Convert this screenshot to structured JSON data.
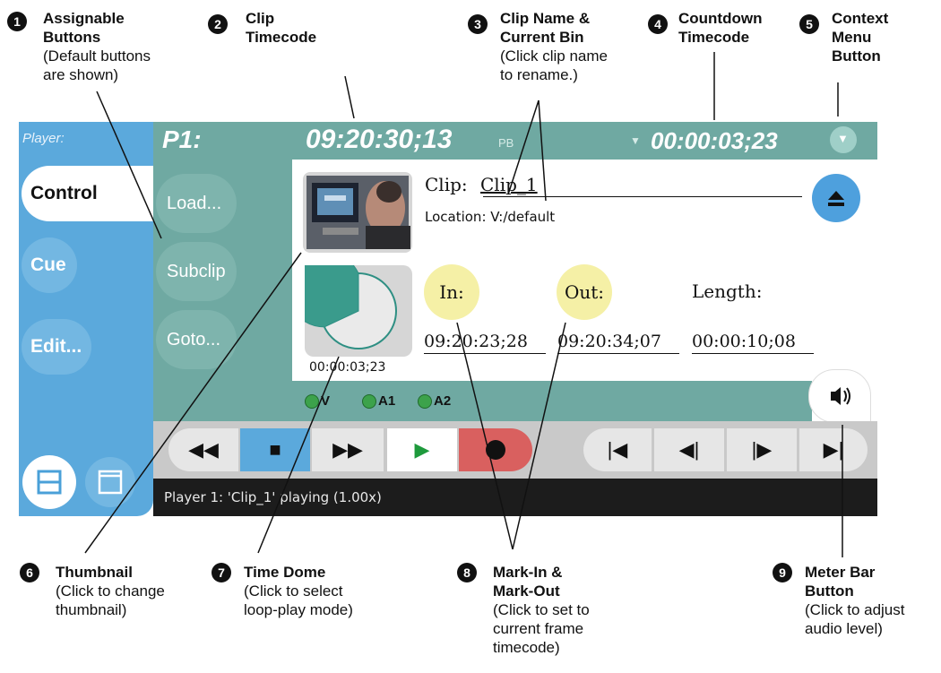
{
  "callouts": [
    {
      "num": "1",
      "title": "Assignable\nButtons",
      "desc": "(Default buttons\nare shown)"
    },
    {
      "num": "2",
      "title": "Clip\nTimecode",
      "desc": ""
    },
    {
      "num": "3",
      "title": "Clip Name &\nCurrent Bin",
      "desc": "(Click clip name\nto rename.)"
    },
    {
      "num": "4",
      "title": "Countdown\nTimecode",
      "desc": ""
    },
    {
      "num": "5",
      "title": "Context\nMenu\nButton",
      "desc": ""
    },
    {
      "num": "6",
      "title": "Thumbnail",
      "desc": "(Click to change\nthumbnail)"
    },
    {
      "num": "7",
      "title": "Time Dome",
      "desc": "(Click to select\nloop-play mode)"
    },
    {
      "num": "8",
      "title": "Mark-In &\nMark-Out",
      "desc": "(Click to set to\ncurrent frame\ntimecode)"
    },
    {
      "num": "9",
      "title": "Meter Bar\nButton",
      "desc": "(Click to adjust\naudio level)"
    }
  ],
  "sidebar": {
    "label": "Player:",
    "tabs": [
      "Control",
      "Cue",
      "Edit..."
    ]
  },
  "header": {
    "player": "P1:",
    "clip_timecode": "09:20:30;13",
    "mode": "PB",
    "countdown": "00:00:03;23"
  },
  "assignable_buttons": [
    "Load...",
    "Subclip",
    "Goto..."
  ],
  "clip": {
    "label": "Clip:",
    "name": "Clip_1",
    "location": "Location: V:/default"
  },
  "time_dome": {
    "value": "00:00:03;23",
    "fill_fraction": 0.68
  },
  "marks": {
    "in_label": "In:",
    "out_label": "Out:",
    "length_label": "Length:",
    "in_value": "09:20:23;28",
    "out_value": "09:20:34;07",
    "length_value": "00:00:10;08"
  },
  "tracks": [
    "V",
    "A1",
    "A2"
  ],
  "status": "Player 1: 'Clip_1' playing (1.00x)",
  "colors": {
    "accent": "#5ba9dc",
    "panel": "#6fa9a2",
    "record": "#d9605f",
    "play": "#1e9a3c"
  }
}
